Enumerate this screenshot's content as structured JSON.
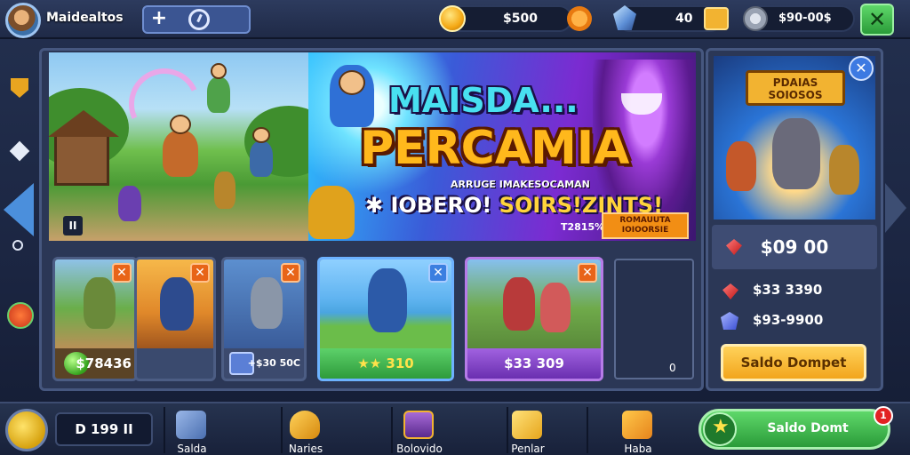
{
  "header": {
    "player_name": "Maidealtos",
    "plus_label": "+",
    "coins": "$500",
    "gems": "40",
    "silver": "$90-00$",
    "close_label": "✕"
  },
  "banner": {
    "title_line1": "MAISDA...",
    "title_line2": "PERCAMIA",
    "subline": "ARRUGE IMAKESOCAMAN",
    "promo_left": "✱ IOBERO!",
    "promo_right": "SOIRS!ZINTS!",
    "promo_code": "T2815%",
    "promo_tag": "ROMAUUTA IOIOORSIE",
    "pause_label": "II"
  },
  "cards": [
    {
      "price": "$78436",
      "badge": "✕"
    },
    {
      "price": "",
      "badge": "✕"
    },
    {
      "price": "+$30 50C",
      "badge": "✕"
    },
    {
      "price": "★★ 310",
      "badge": "✕"
    },
    {
      "price": "$33 309",
      "badge": "✕"
    }
  ],
  "empty_card_label": "0",
  "offer": {
    "sign_text": "PDAIAS SOIOSOS",
    "close_label": "✕",
    "price": "$09 00",
    "row1": "$33 3390",
    "row2": "$93-9900",
    "buy_label": "Saldo Dompet"
  },
  "bottom": {
    "counter": "D 199 II",
    "items": [
      {
        "label": "Salda"
      },
      {
        "label": "Naries"
      },
      {
        "label": "Bolovido"
      },
      {
        "label": "Penlar"
      },
      {
        "label": "Haba"
      }
    ],
    "cta_label": "Saldo Domt",
    "cta_badge": "1"
  },
  "colors": {
    "accent_green": "#2a9b39",
    "accent_gold": "#f2a51c",
    "panel": "#2b3756"
  }
}
